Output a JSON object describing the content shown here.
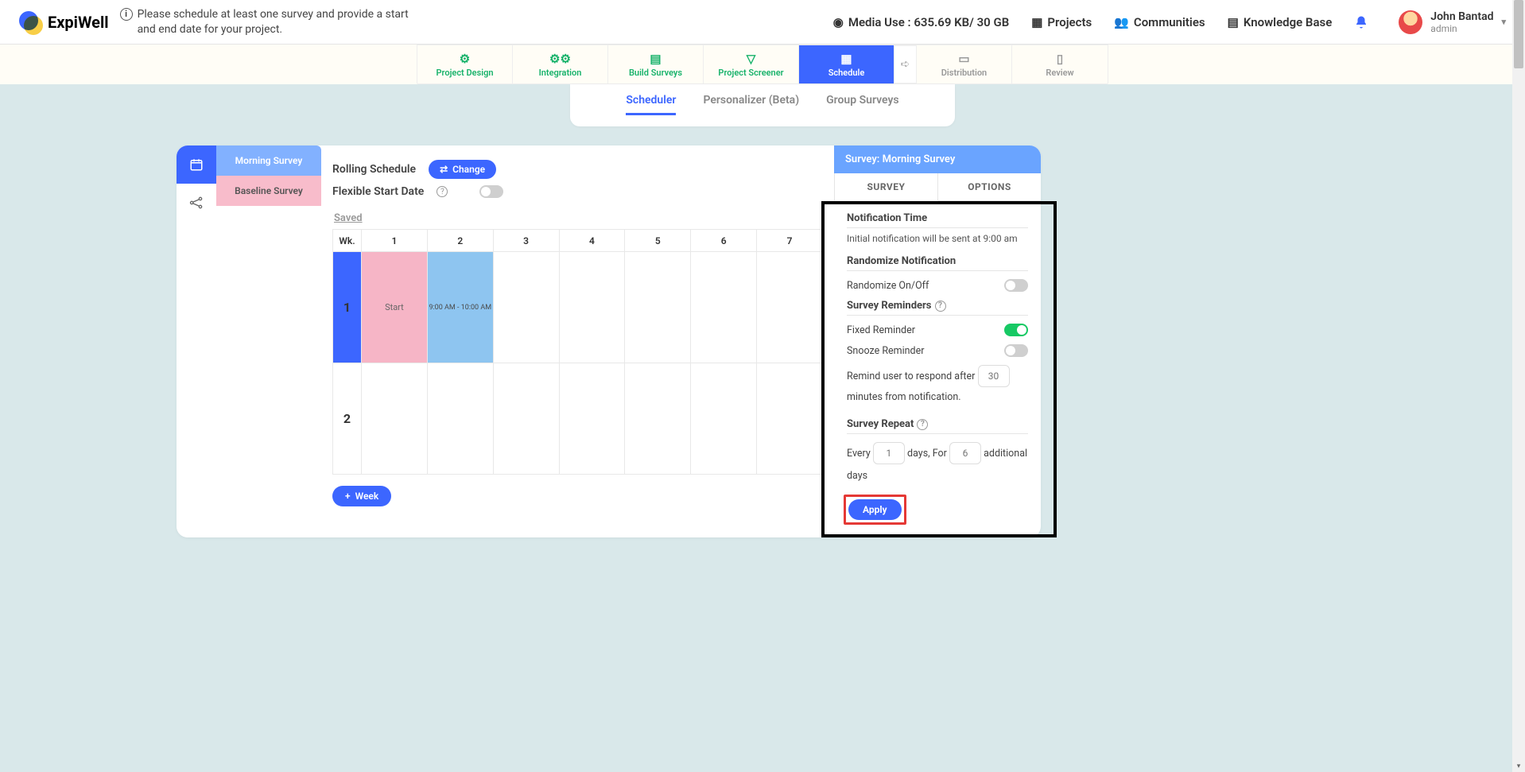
{
  "brand": "ExpiWell",
  "header_notice": "Please schedule at least one survey and provide a start and end date for your project.",
  "media_use": "Media Use : 635.69 KB/ 30 GB",
  "nav": {
    "projects": "Projects",
    "communities": "Communities",
    "kb": "Knowledge Base"
  },
  "user": {
    "name": "John Bantad",
    "role": "admin"
  },
  "proj_tabs": [
    "Project Design",
    "Integration",
    "Build Surveys",
    "Project Screener",
    "Schedule",
    "Distribution",
    "Review"
  ],
  "proj_tabs_active": 4,
  "sub_tabs": [
    "Scheduler",
    "Personalizer (Beta)",
    "Group Surveys"
  ],
  "sub_tabs_active": 0,
  "survey_list": [
    {
      "label": "Morning Survey",
      "cls": "active"
    },
    {
      "label": "Baseline Survey",
      "cls": "alt"
    }
  ],
  "center": {
    "rolling": "Rolling Schedule",
    "change": "Change",
    "flex": "Flexible Start Date",
    "saved": "Saved",
    "wk": "Wk.",
    "cols": [
      "1",
      "2",
      "3",
      "4",
      "5",
      "6",
      "7"
    ],
    "rows": [
      "1",
      "2"
    ],
    "start_label": "Start",
    "time_label": "9:00 AM - 10:00 AM",
    "add_week": "Week"
  },
  "right": {
    "header_prefix": "Survey: ",
    "header_name": "Morning Survey",
    "tabs": [
      "SURVEY",
      "OPTIONS"
    ],
    "active_tab": 0,
    "notif_title": "Notification Time",
    "notif_desc": "Initial notification will be sent at 9:00 am",
    "rand_title": "Randomize Notification",
    "rand_row": "Randomize On/Off",
    "rem_title": "Survey Reminders",
    "fixed": "Fixed Reminder",
    "snooze": "Snooze Reminder",
    "remind_pre": "Remind user to respond after",
    "remind_val": "30",
    "remind_post": "minutes from notification.",
    "repeat_title": "Survey Repeat",
    "every": "Every",
    "every_val": "1",
    "days_for": "days, For",
    "for_val": "6",
    "additional": "additional days",
    "apply": "Apply"
  }
}
